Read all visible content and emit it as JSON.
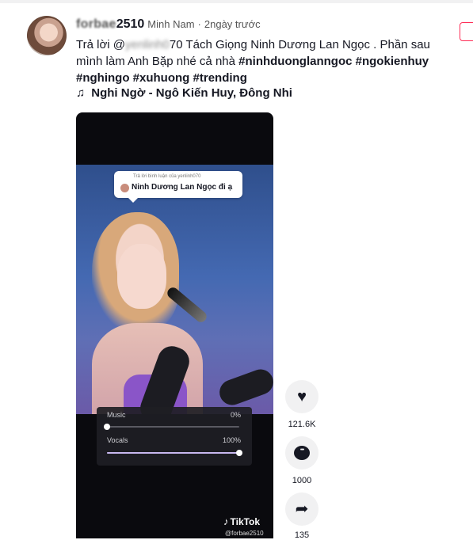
{
  "post": {
    "username_prefix": "forbae",
    "username_suffix": "2510",
    "nickname": "Minh Nam",
    "separator": "·",
    "time": "2ngày trước",
    "caption": {
      "reply_prefix": "Trả lời @",
      "mention_blurred": "yenlinh0",
      "mention_visible": "70",
      "text": " Tách Giọng Ninh Dương Lan Ngọc . Phần sau mình làm Anh Bặp nhé cả nhà ",
      "hashtags": [
        "#ninhduonglanngoc",
        "#ngokienhuy",
        "#nghingo",
        "#xuhuong",
        "#trending"
      ]
    },
    "music_icon": "music-note-icon",
    "music": "Nghi Ngờ - Ngô Kiến Huy, Đông Nhi"
  },
  "video": {
    "reply_note": "Trả lời bình luận của yenlinh070",
    "reply_text": "Ninh Dương Lan Ngọc đi ạ",
    "mixer": {
      "music_label": "Music",
      "music_value": "0%",
      "music_level": 0,
      "vocals_label": "Vocals",
      "vocals_value": "100%",
      "vocals_level": 1.0
    },
    "watermark": {
      "logo_icon": "tiktok-logo-icon",
      "brand": "TikTok",
      "handle": "@forbae2510"
    }
  },
  "actions": {
    "like_icon": "heart-icon",
    "like_count": "121.6K",
    "comment_icon": "comment-icon",
    "comment_count": "1000",
    "share_icon": "share-icon",
    "share_count": "135"
  },
  "colors": {
    "accent": "#fe2c55",
    "text": "#161823",
    "action_bg": "#f1f1f2"
  }
}
